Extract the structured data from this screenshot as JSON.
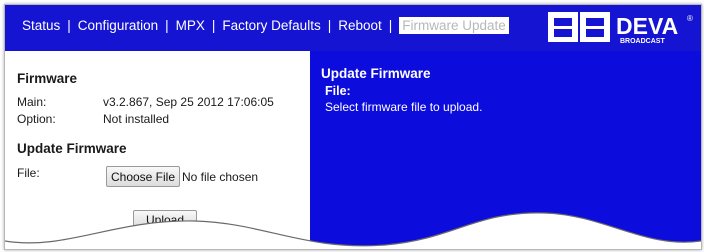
{
  "nav": {
    "items": [
      "Status",
      "Configuration",
      "MPX",
      "Factory Defaults",
      "Reboot"
    ],
    "active": "Firmware Update",
    "separator": "|"
  },
  "logo": {
    "brand": "DEVA",
    "sub": "BROADCAST",
    "mark": "DB",
    "registered": "®"
  },
  "firmware": {
    "title": "Firmware",
    "main_label": "Main:",
    "main_value": "v3.2.867, Sep 25 2012 17:06:05",
    "option_label": "Option:",
    "option_value": "Not installed"
  },
  "update": {
    "title": "Update Firmware",
    "file_label": "File:",
    "choose_button": "Choose File",
    "no_file_text": "No file chosen",
    "upload_button": "Upload"
  },
  "help": {
    "title": "Update Firmware",
    "field": "File:",
    "text": "Select firmware file to upload."
  },
  "colors": {
    "nav_bg": "#1414d2",
    "help_bg": "#0c0cdc"
  }
}
